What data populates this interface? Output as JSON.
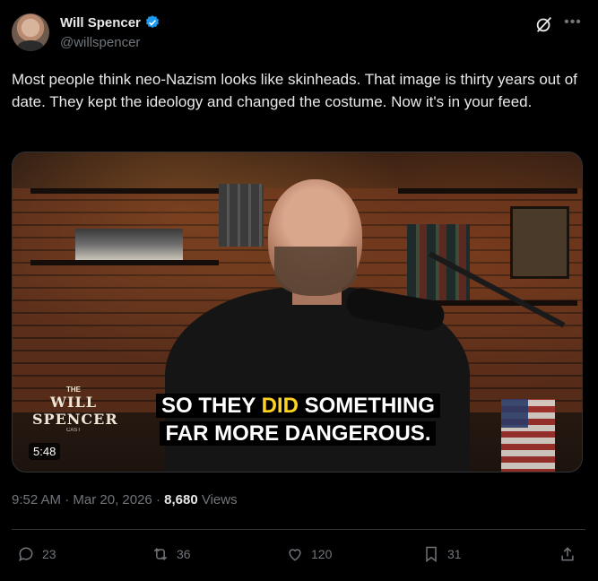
{
  "author": {
    "name": "Will Spencer",
    "handle": "@willspencer",
    "verified": true
  },
  "tweet": {
    "text": "Most people think neo-Nazism looks like skinheads. That image is thirty years out of date. They kept the ideology and changed the costume. Now it's in your feed."
  },
  "media": {
    "caption_line1_part1": "SO THEY ",
    "caption_line1_highlight": "DID",
    "caption_line1_part2": " SOMETHING",
    "caption_line2": "FAR MORE DANGEROUS.",
    "duration": "5:48",
    "logo_the": "THE",
    "logo_will": "WILL",
    "logo_spencer": "SPENCER",
    "logo_small": "CAST"
  },
  "meta": {
    "time": "9:52 AM",
    "date": "Mar 20, 2026",
    "views_count": "8,680",
    "views_label": "Views"
  },
  "actions": {
    "replies": "23",
    "reposts": "36",
    "likes": "120",
    "bookmarks": "31"
  },
  "icons": {
    "more": "more-options-icon",
    "grok": "grok-icon"
  },
  "colors": {
    "accent": "#1d9bf0",
    "text": "#e7e9ea",
    "muted": "#71767b",
    "caption_highlight": "#ffd21f"
  }
}
